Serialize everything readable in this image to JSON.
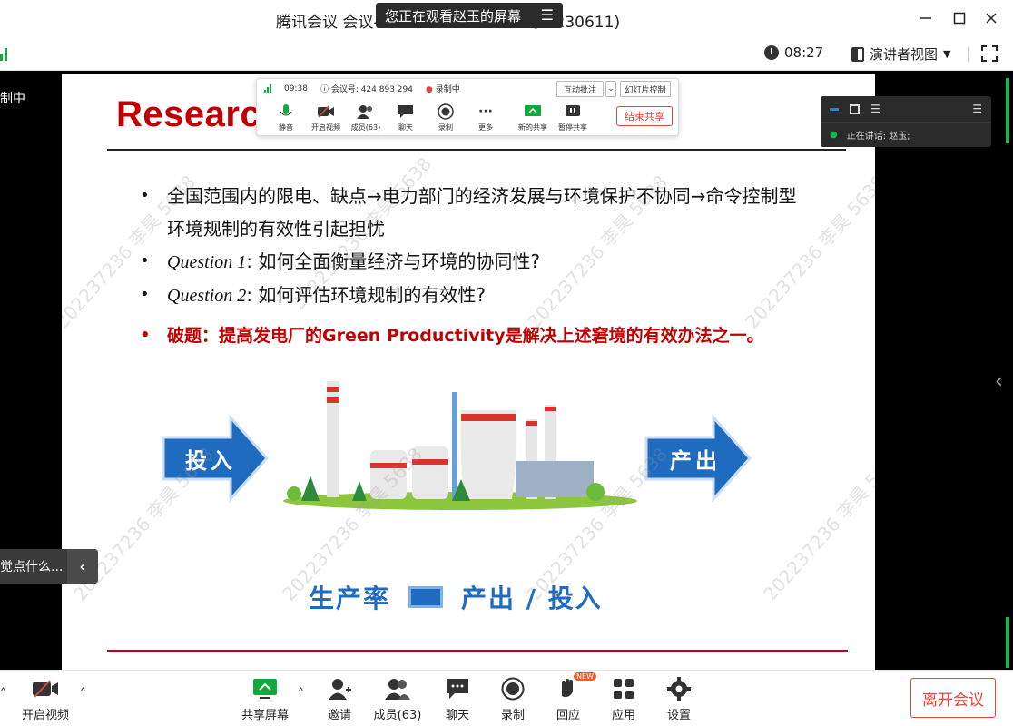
{
  "window": {
    "title": "腾讯会议 会议号：230611)",
    "title_visible": "腾讯会议 会议-",
    "title_suffix": "码：230611)"
  },
  "banner": {
    "text": "您正在观看赵玉的屏幕"
  },
  "subbar": {
    "elapsed_time": "08:27",
    "view_mode": "演讲者视图"
  },
  "left_overlay": {
    "recording_text": "制中",
    "chat_preview": "觉点什么..."
  },
  "slide": {
    "title": "Researc",
    "bullets": [
      {
        "text": "全国范围内的限电、缺点→电力部门的经济发展与环境保护不协同→命令控制型环境规制的有效性引起担忧"
      },
      {
        "label": "Question 1",
        "text": ": 如何全面衡量经济与环境的协同性?"
      },
      {
        "label": "Question 2",
        "text": ": 如何评估环境规制的有效性?"
      },
      {
        "text": "破题：提高发电厂的Green Productivity是解决上述窘境的有效办法之一。"
      }
    ],
    "input_label": "投入",
    "output_label": "产出",
    "formula": {
      "left": "生产率",
      "right": "产出 / 投入"
    },
    "watermark": "202237236 李昊 5638"
  },
  "floating_bar": {
    "time": "09:38",
    "meeting_id": "会议号: 424 893 294",
    "recording": "录制中",
    "annotate": "互动批注",
    "slide_control": "幻灯片控制",
    "items": [
      "静音",
      "开启视频",
      "成员(63)",
      "聊天",
      "录制",
      "更多",
      "新的共享",
      "暂停共享"
    ],
    "end_share": "结束共享"
  },
  "speaker_panel": {
    "label": "正在讲话:",
    "name": "赵玉;"
  },
  "bottom_toolbar": {
    "video": "开启视频",
    "share": "共享屏幕",
    "invite": "邀请",
    "members": "成员(63)",
    "chat": "聊天",
    "record": "录制",
    "react": "回应",
    "apps": "应用",
    "settings": "设置",
    "leave": "离开会议",
    "new_badge": "NEW"
  },
  "colors": {
    "slide_title": "#c00000",
    "accent_green": "#15b84d",
    "danger": "#e0463a",
    "blue_arrow": "#1f6bbf"
  }
}
